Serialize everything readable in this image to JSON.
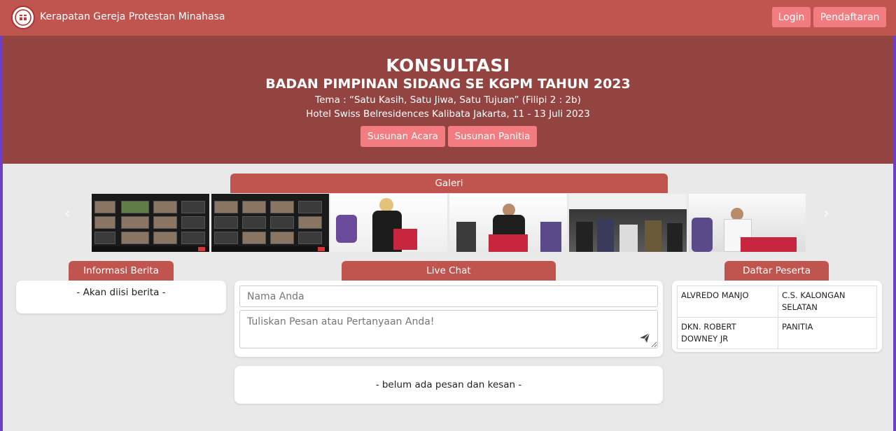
{
  "navbar": {
    "brand": "Kerapatan Gereja Protestan Minahasa",
    "login_label": "Login",
    "register_label": "Pendaftaran"
  },
  "hero": {
    "title": "KONSULTASI",
    "subtitle": "BADAN PIMPINAN SIDANG SE KGPM TAHUN 2023",
    "tema": "Tema : “Satu Kasih, Satu Jiwa, Satu Tujuan” (Filipi 2 : 2b)",
    "lokasi": "Hotel Swiss Belresidences Kalibata Jakarta, 11 - 13 Juli 2023",
    "btn_acara": "Susunan Acara",
    "btn_panitia": "Susunan Panitia"
  },
  "galeri": {
    "title": "Galeri",
    "prev_icon": "‹",
    "next_icon": "›"
  },
  "berita": {
    "title": "Informasi Berita",
    "placeholder_text": "- Akan diisi berita -"
  },
  "chat": {
    "title": "Live Chat",
    "name_placeholder": "Nama Anda",
    "message_placeholder": "Tuliskan Pesan atau Pertanyaan Anda!",
    "empty_text": "- belum ada pesan dan kesan -"
  },
  "peserta": {
    "title": "Daftar Peserta",
    "rows": [
      [
        "ALVREDO MANJO",
        "C.S. KALONGAN SELATAN"
      ],
      [
        "DKN. ROBERT DOWNEY JR",
        "PANITIA"
      ]
    ]
  },
  "colors": {
    "navbar": "#c0554f",
    "hero": "#944440",
    "button": "#f27c80",
    "background": "#e9e9e9"
  }
}
